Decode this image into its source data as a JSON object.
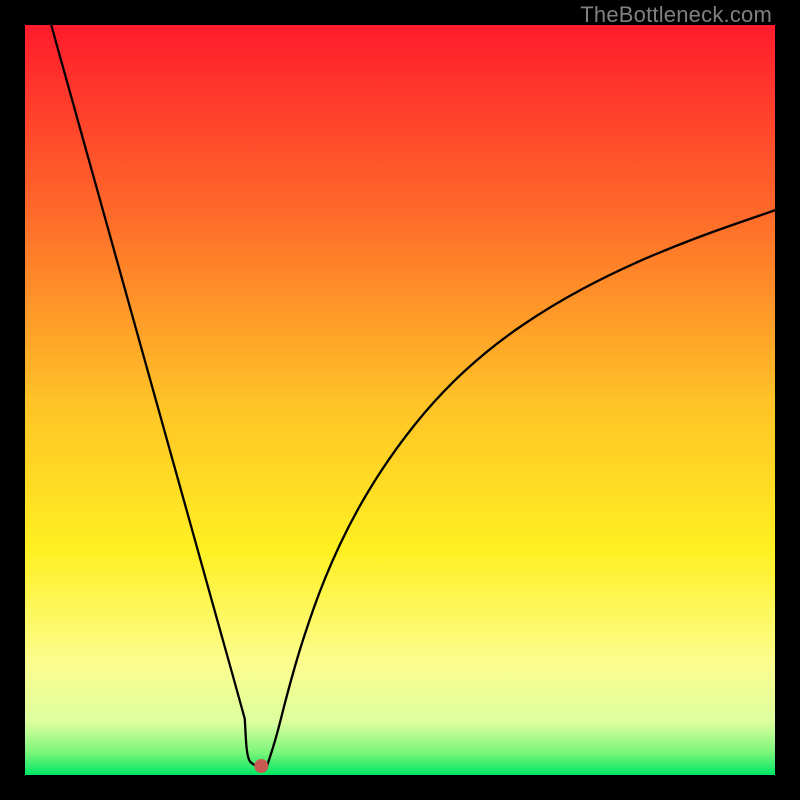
{
  "watermark": "TheBottleneck.com",
  "chart_data": {
    "type": "line",
    "title": "",
    "xlabel": "",
    "ylabel": "",
    "xlim": [
      0,
      100
    ],
    "ylim": [
      0,
      100
    ],
    "grid": false,
    "legend": false,
    "background_gradient": {
      "stops": [
        {
          "offset": 0.0,
          "color": "#ff1b2c"
        },
        {
          "offset": 0.25,
          "color": "#ff6a2a"
        },
        {
          "offset": 0.5,
          "color": "#ffc227"
        },
        {
          "offset": 0.7,
          "color": "#fff022"
        },
        {
          "offset": 0.85,
          "color": "#fdfd8e"
        },
        {
          "offset": 0.93,
          "color": "#dcff9e"
        },
        {
          "offset": 0.97,
          "color": "#7af57a"
        },
        {
          "offset": 1.0,
          "color": "#00e765"
        }
      ]
    },
    "marker": {
      "x": 31.5,
      "y": 1.2,
      "color": "#c85a52",
      "r": 7
    },
    "series": [
      {
        "name": "left-branch",
        "stroke": "#000000",
        "stroke_width": 2.3,
        "x": [
          3.5,
          6,
          9,
          12,
          15,
          18,
          21,
          24,
          27,
          28.5,
          29.3
        ],
        "y": [
          100,
          91,
          80.3,
          69.5,
          58.8,
          48,
          37.3,
          26.5,
          15.8,
          10.4,
          7.5
        ]
      },
      {
        "name": "flat-bottom",
        "stroke": "#000000",
        "stroke_width": 2.3,
        "x": [
          29.3,
          29.6,
          30.5,
          31.5,
          32.3
        ],
        "y": [
          7.5,
          2.2,
          1.3,
          1.1,
          1.3
        ]
      },
      {
        "name": "right-branch",
        "stroke": "#000000",
        "stroke_width": 2.3,
        "x": [
          32.3,
          33.5,
          35,
          37,
          40,
          44,
          49,
          55,
          62,
          70,
          79,
          89,
          100
        ],
        "y": [
          1.3,
          5,
          11,
          18,
          26.5,
          35,
          43,
          50.5,
          57,
          62.5,
          67.3,
          71.5,
          75.3
        ]
      }
    ]
  }
}
